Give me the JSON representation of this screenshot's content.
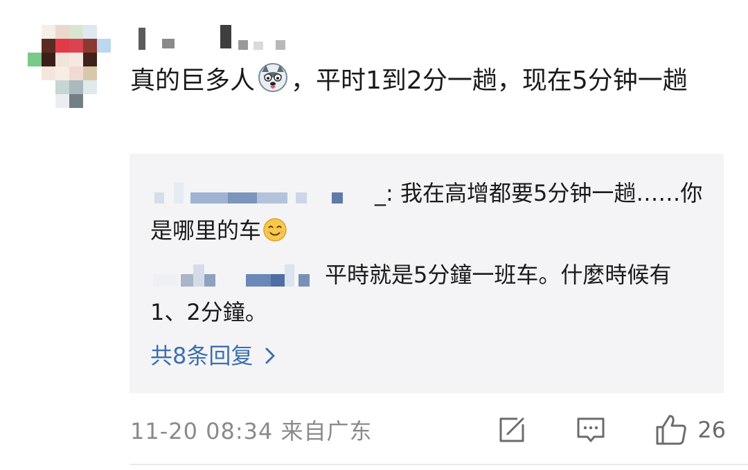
{
  "comment": {
    "text_before_emoji": "真的巨多人",
    "emoji_name": "husky-emoji",
    "text_after_emoji": "，平时1到2分一趟，现在5分钟一趟"
  },
  "replies": [
    {
      "separator": "_: ",
      "text": "我在高增都要5分钟一趟……你是哪里的车",
      "emoji_name": "smile-emoji"
    },
    {
      "separator": "",
      "text": "平時就是5分鐘一班车。什麼時候有1、2分鐘。"
    }
  ],
  "more_replies_label": "共8条回复",
  "footer": {
    "meta": "11-20 08:34 来自广东",
    "like_count": "26",
    "icons": [
      "share-icon",
      "comment-icon",
      "like-icon"
    ]
  },
  "colors": {
    "link": "#3b6fb0",
    "meta_gray": "#8a8a8a",
    "reply_bg": "#f4f4f6"
  }
}
